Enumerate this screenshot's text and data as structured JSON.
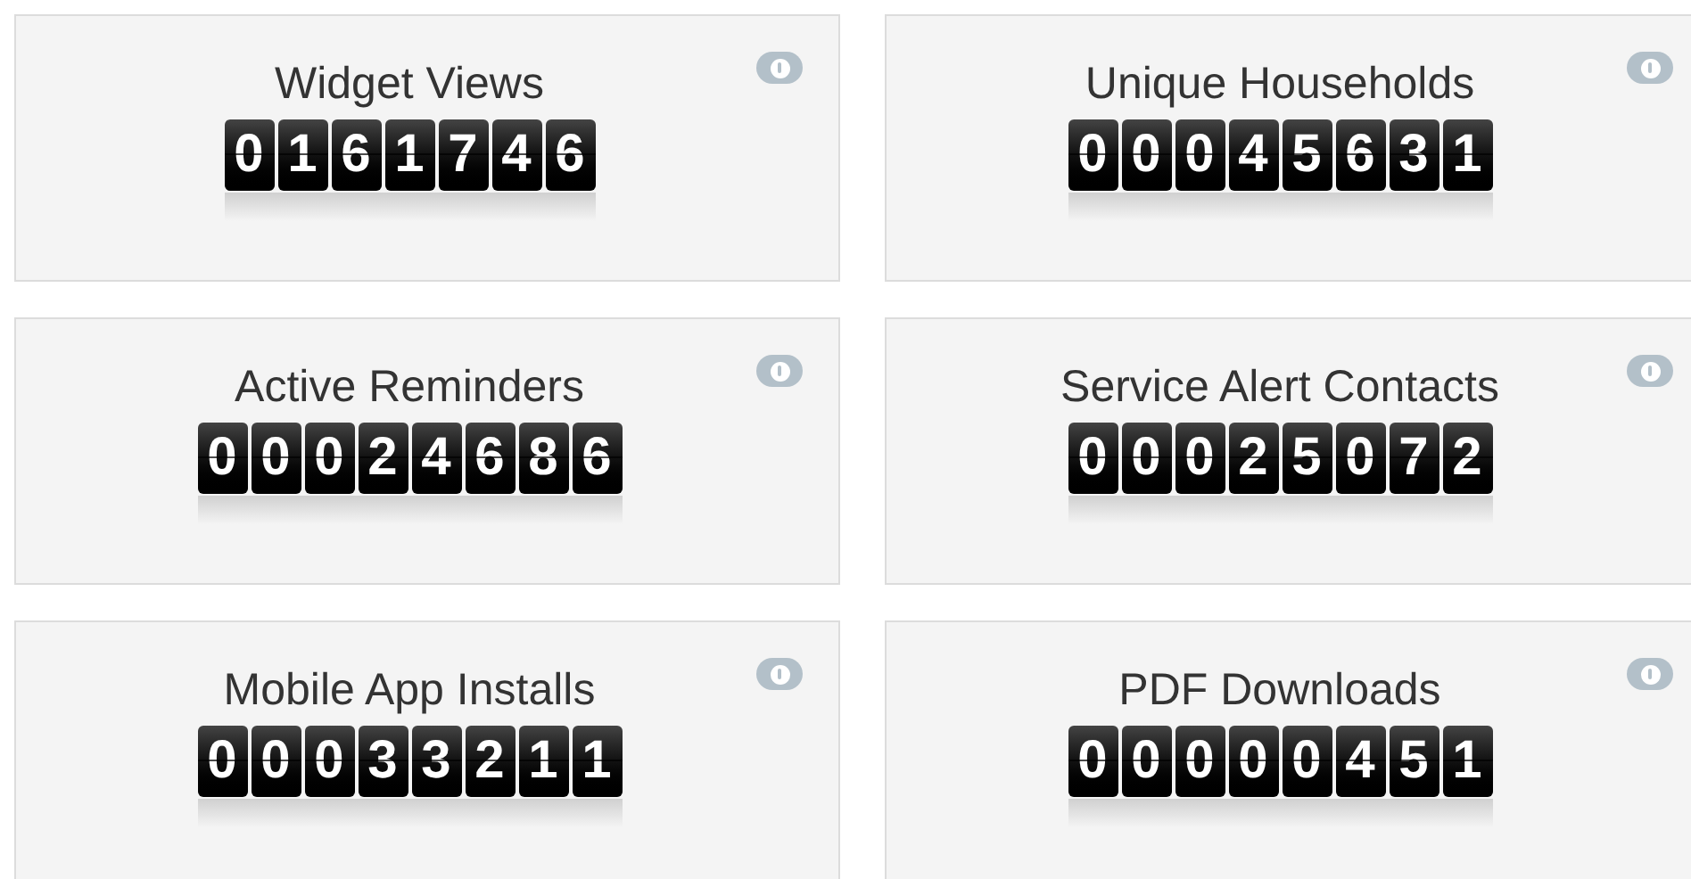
{
  "counters": [
    {
      "title": "Widget Views",
      "digits": [
        "0",
        "1",
        "6",
        "1",
        "7",
        "4",
        "6"
      ]
    },
    {
      "title": "Unique Households",
      "digits": [
        "0",
        "0",
        "0",
        "4",
        "5",
        "6",
        "3",
        "1"
      ]
    },
    {
      "title": "Active Reminders",
      "digits": [
        "0",
        "0",
        "0",
        "2",
        "4",
        "6",
        "8",
        "6"
      ]
    },
    {
      "title": "Service Alert Contacts",
      "digits": [
        "0",
        "0",
        "0",
        "2",
        "5",
        "0",
        "7",
        "2"
      ]
    },
    {
      "title": "Mobile App Installs",
      "digits": [
        "0",
        "0",
        "0",
        "3",
        "3",
        "2",
        "1",
        "1"
      ]
    },
    {
      "title": "PDF Downloads",
      "digits": [
        "0",
        "0",
        "0",
        "0",
        "0",
        "4",
        "5",
        "1"
      ]
    }
  ]
}
